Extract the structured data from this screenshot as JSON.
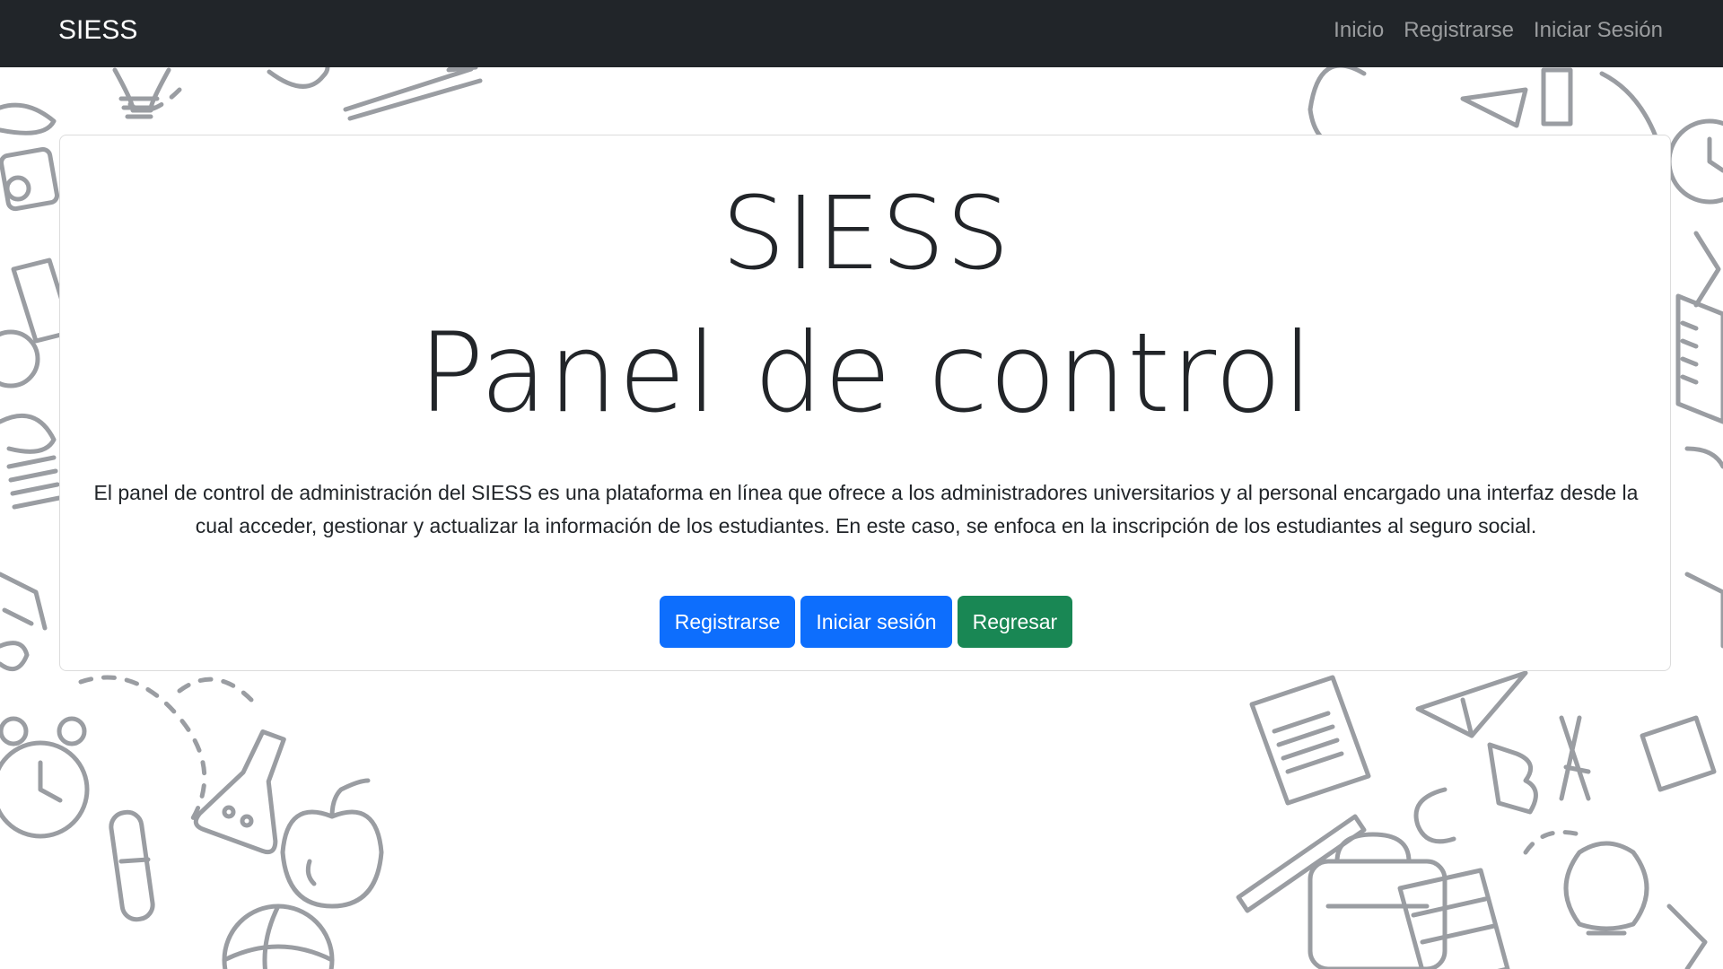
{
  "navbar": {
    "brand": "SIESS",
    "links": [
      "Inicio",
      "Registrarse",
      "Iniciar Sesión"
    ]
  },
  "hero": {
    "title_line1": "SIESS",
    "title_line2": "Panel de control",
    "description": "El panel de control de administración del SIESS es una plataforma en línea que ofrece a los administradores universitarios y al personal encargado una interfaz desde la cual acceder, gestionar y actualizar la información de los estudiantes. En este caso, se enfoca en la inscripción de los estudiantes al seguro social."
  },
  "buttons": {
    "register": "Registrarse",
    "login": "Iniciar sesión",
    "back": "Regresar"
  },
  "colors": {
    "navbar": "#212529",
    "primary": "#0d6efd",
    "success": "#198754",
    "doodle": "#9a9da2"
  },
  "icons": [
    "lightbulb-icon",
    "compass-icon",
    "apple-icon",
    "alarm-clock-icon",
    "flask-icon",
    "test-tube-icon",
    "basketball-icon",
    "paper-plane-icon",
    "document-icon",
    "backpack-icon",
    "ruler-icon",
    "book-icon"
  ]
}
